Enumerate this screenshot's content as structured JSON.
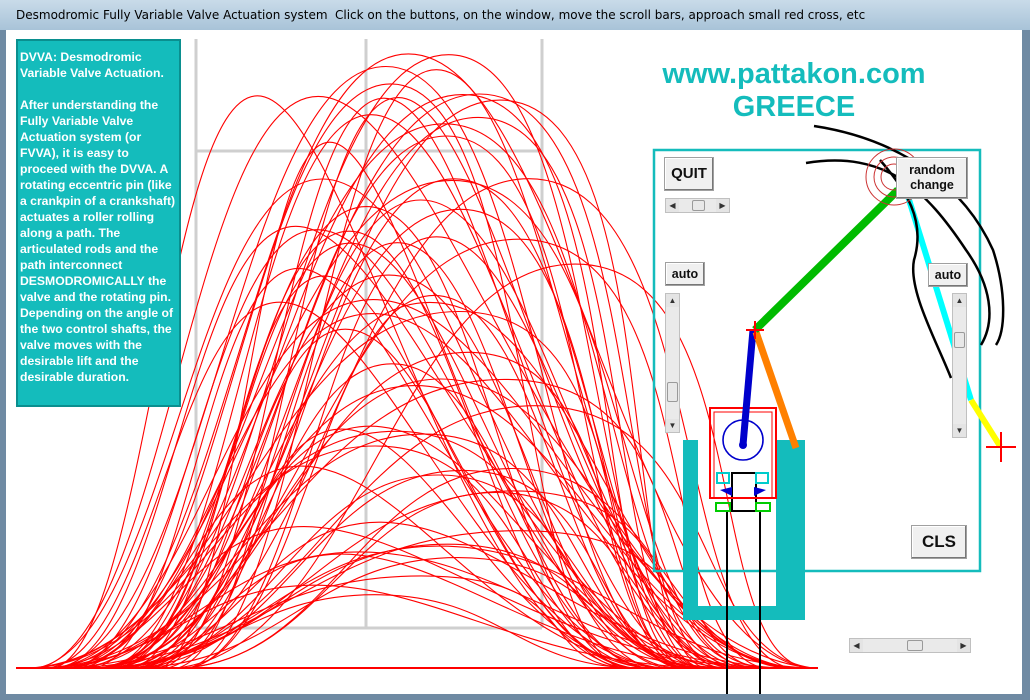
{
  "window": {
    "title": "Desmodromic Fully Variable Valve Actuation system",
    "hint": "Click on the buttons, on the window, move the scroll bars, approach small red cross, etc"
  },
  "info": {
    "heading": "DVVA:  Desmodromic Variable Valve Actuation.",
    "body": "After understanding the Fully Variable Valve Actuation system (or FVVA), it is easy to proceed with the DVVA. A rotating eccentric pin (like a crankpin of a crankshaft) actuates a roller rolling along a path. The articulated rods and the path interconnect DESMODROMICALLY the valve and the rotating pin. Depending on the angle of the two control shafts, the valve moves with the desirable lift and the desirable duration."
  },
  "brand": {
    "site": "www.pattakon.com",
    "country": "GREECE"
  },
  "buttons": {
    "quit": "QUIT",
    "random_change": "random change",
    "auto_left": "auto",
    "auto_right": "auto",
    "cls": "CLS"
  },
  "icons": {
    "arrow_left": "◀",
    "arrow_right": "▶",
    "arrow_up": "▲",
    "arrow_down": "▼"
  },
  "colors": {
    "lift_curves": "#ff0000",
    "accent_teal": "#14bcbc",
    "green_rod": "#00bb00",
    "blue_rod": "#0000cc",
    "orange_rod": "#ff8000",
    "cyan_rod": "#00ffff",
    "yellow_rod": "#ffff00"
  }
}
